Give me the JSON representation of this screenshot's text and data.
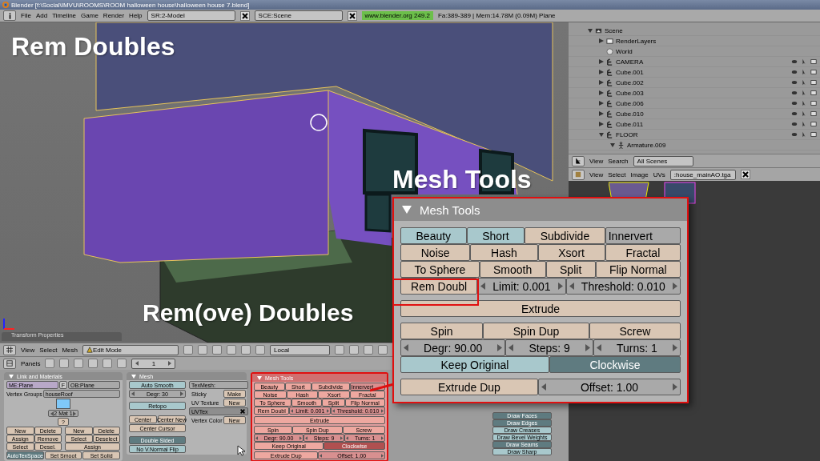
{
  "window": {
    "title": "Blender [f:\\Social\\IMVU\\ROOMS\\ROOM halloween house\\halloween house 7.blend]"
  },
  "menu_bar": {
    "items": [
      "File",
      "Add",
      "Timeline",
      "Game",
      "Render",
      "Help"
    ],
    "screen": "SR:2-Model",
    "scene": "SCE:Scene",
    "link": "www.blender.org 249.2",
    "stats": "Fa:389-389 | Mem:14.78M (0.09M) Plane"
  },
  "annotations": [
    "Rem Doubles",
    "Mesh Tools",
    "Rem(ove) Doubles"
  ],
  "transform_tab": "Transform Properties",
  "viewport_header": {
    "menus": [
      "View",
      "Select",
      "Mesh"
    ],
    "mode": "Edit Mode",
    "orientation": "Local"
  },
  "buttons_header": {
    "label": "Panels",
    "frame": "1"
  },
  "link_materials": {
    "title": "Link and Materials",
    "mesh": "ME:Plane",
    "fake": "F",
    "object": "OB:Plane",
    "vertex_groups_label": "Vertex Groups",
    "vertex_group": "houseRoof",
    "material": "2 Mat 1",
    "help": "?",
    "vg_buttons": [
      "New",
      "Delete",
      "Assign",
      "Remove",
      "Select",
      "Desel."
    ],
    "mat_buttons": [
      "New",
      "Delete",
      "Select",
      "Deselect",
      "Assign"
    ],
    "autotex": {
      "label": "AutoTexSpace",
      "on": true
    },
    "smooth_buttons": [
      "Set Smoot",
      "Set Solid"
    ]
  },
  "mesh": {
    "title": "Mesh",
    "auto_smooth": {
      "label": "Auto Smooth",
      "on": false
    },
    "degr": "Degr: 30",
    "retopo": {
      "label": "Retopo",
      "on": false
    },
    "center": [
      "Center",
      "Center New",
      "Center Cursor"
    ],
    "double_sided": {
      "label": "Double Sided",
      "on": true
    },
    "no_vnormal_flip": {
      "label": "No V.Normal Flip",
      "on": false
    },
    "texmesh": "TexMesh:",
    "sticky": {
      "label": "Sticky",
      "button": "Make"
    },
    "uv_texture": {
      "label": "UV Texture",
      "button": "New"
    },
    "uvtex": "UVTex",
    "vertex_color": {
      "label": "Vertex Color",
      "button": "New"
    }
  },
  "mesh_tools_panel": {
    "title": "Mesh Tools",
    "rows": [
      [
        {
          "label": "Beauty",
          "kind": "toggle",
          "on": false
        },
        {
          "label": "Short",
          "kind": "toggle",
          "on": false
        },
        {
          "label": "Subdivide",
          "kind": "button"
        },
        {
          "label": "Innervert",
          "kind": "menu"
        }
      ],
      [
        {
          "label": "Noise",
          "kind": "button"
        },
        {
          "label": "Hash",
          "kind": "button"
        },
        {
          "label": "Xsort",
          "kind": "button"
        },
        {
          "label": "Fractal",
          "kind": "button"
        }
      ],
      [
        {
          "label": "To Sphere",
          "kind": "button"
        },
        {
          "label": "Smooth",
          "kind": "button"
        },
        {
          "label": "Split",
          "kind": "button"
        },
        {
          "label": "Flip Normal",
          "kind": "button"
        }
      ],
      [
        {
          "label": "Rem Doubl",
          "kind": "button"
        },
        {
          "label": "Limit: 0.001",
          "kind": "number"
        },
        {
          "label": "Threshold: 0.010",
          "kind": "number"
        }
      ],
      [
        {
          "label": "Extrude",
          "kind": "button"
        }
      ],
      [
        {
          "label": "Spin",
          "kind": "button"
        },
        {
          "label": "Spin Dup",
          "kind": "button"
        },
        {
          "label": "Screw",
          "kind": "button"
        }
      ],
      [
        {
          "label": "Degr: 90.00",
          "kind": "number"
        },
        {
          "label": "Steps: 9",
          "kind": "number"
        },
        {
          "label": "Turns: 1",
          "kind": "number"
        }
      ],
      [
        {
          "label": "Keep Original",
          "kind": "toggle",
          "on": false
        },
        {
          "label": "Clockwise",
          "kind": "toggle",
          "on": true
        }
      ],
      [
        {
          "label": "Extrude Dup",
          "kind": "button"
        },
        {
          "label": "Offset: 1.00",
          "kind": "number"
        }
      ]
    ]
  },
  "mesh_tools_zoom": {
    "title": "Mesh Tools",
    "rows": [
      [
        {
          "label": "Beauty",
          "kind": "toggle",
          "on": false
        },
        {
          "label": "Short",
          "kind": "toggle",
          "on": false
        },
        {
          "label": "Subdivide",
          "kind": "button"
        },
        {
          "label": "Innervert",
          "kind": "menu"
        }
      ],
      [
        {
          "label": "Noise",
          "kind": "button"
        },
        {
          "label": "Hash",
          "kind": "button"
        },
        {
          "label": "Xsort",
          "kind": "button"
        },
        {
          "label": "Fractal",
          "kind": "button"
        }
      ],
      [
        {
          "label": "To Sphere",
          "kind": "button"
        },
        {
          "label": "Smooth",
          "kind": "button"
        },
        {
          "label": "Split",
          "kind": "button"
        },
        {
          "label": "Flip Normal",
          "kind": "button"
        }
      ],
      [
        {
          "label": "Rem Doubl",
          "kind": "button"
        },
        {
          "label": "Limit: 0.001",
          "kind": "number"
        },
        {
          "label": "Threshold: 0.010",
          "kind": "number"
        }
      ],
      [
        {
          "label": "Extrude",
          "kind": "button"
        }
      ],
      [
        {
          "label": "Spin",
          "kind": "button"
        },
        {
          "label": "Spin Dup",
          "kind": "button"
        },
        {
          "label": "Screw",
          "kind": "button"
        }
      ],
      [
        {
          "label": "Degr: 90.00",
          "kind": "number"
        },
        {
          "label": "Steps: 9",
          "kind": "number"
        },
        {
          "label": "Turns: 1",
          "kind": "number"
        }
      ],
      [
        {
          "label": "Keep Original",
          "kind": "toggle",
          "on": false
        },
        {
          "label": "Clockwise",
          "kind": "toggle",
          "on": true
        }
      ],
      [
        {
          "label": "Extrude Dup",
          "kind": "button"
        },
        {
          "label": "Offset: 1.00",
          "kind": "number"
        }
      ]
    ]
  },
  "draw_panel": {
    "toggles": [
      {
        "label": "Draw Faces",
        "on": true
      },
      {
        "label": "Draw Edges",
        "on": true
      },
      {
        "label": "Draw Creases",
        "on": false
      },
      {
        "label": "Draw Bevel Weights",
        "on": false
      },
      {
        "label": "Draw Seams",
        "on": true
      },
      {
        "label": "Draw Sharp",
        "on": false
      }
    ]
  },
  "outliner": {
    "tree": [
      {
        "name": "Scene",
        "kind": "scene",
        "expanded": true,
        "children": [
          {
            "name": "RenderLayers",
            "kind": "layers",
            "expanded": false
          },
          {
            "name": "World",
            "kind": "world"
          },
          {
            "name": "CAMERA",
            "kind": "object",
            "expanded": false
          },
          {
            "name": "Cube.001",
            "kind": "object",
            "expanded": false
          },
          {
            "name": "Cube.002",
            "kind": "object",
            "expanded": false
          },
          {
            "name": "Cube.003",
            "kind": "object",
            "expanded": false
          },
          {
            "name": "Cube.006",
            "kind": "object",
            "expanded": false
          },
          {
            "name": "Cube.010",
            "kind": "object",
            "expanded": false
          },
          {
            "name": "Cube.011",
            "kind": "object",
            "expanded": false
          },
          {
            "name": "FLOOR",
            "kind": "object",
            "expanded": true,
            "children": [
              {
                "name": "Armature.009",
                "kind": "armature",
                "expanded": true
              }
            ]
          }
        ]
      }
    ],
    "menus": [
      "View",
      "Search"
    ],
    "filter": "All Scenes"
  },
  "image_editor": {
    "menus": [
      "View",
      "Select",
      "Image",
      "UVs"
    ],
    "image": ":house_mainAO.tga"
  }
}
